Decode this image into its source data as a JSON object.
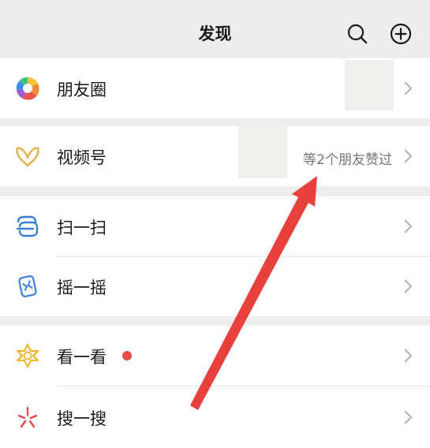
{
  "header": {
    "title": "发现",
    "search_icon": "search-icon",
    "add_icon": "plus-circle-icon"
  },
  "menu": {
    "moments": {
      "label": "朋友圈",
      "icon": "moments-aperture-icon"
    },
    "channels": {
      "label": "视频号",
      "note": "等2个朋友赞过",
      "icon": "channels-butterfly-icon"
    },
    "scan": {
      "label": "扫一扫",
      "icon": "scan-icon"
    },
    "shake": {
      "label": "摇一摇",
      "icon": "shake-icon"
    },
    "top_stories": {
      "label": "看一看",
      "icon": "top-stories-star-icon",
      "has_red_dot": true
    },
    "search": {
      "label": "搜一搜",
      "icon": "search-sparkle-icon"
    }
  },
  "colors": {
    "background": "#ededed",
    "row": "#ffffff",
    "text": "#1a1a1a",
    "note": "#737373",
    "badge_dot": "#e94b4b",
    "annotation_arrow": "#e8403a"
  }
}
